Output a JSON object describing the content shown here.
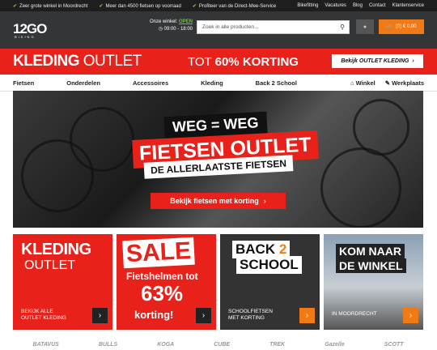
{
  "topbar": {
    "usps": [
      "Zeer grote winkel in Moordrecht",
      "Meer dan 4500 fietsen op voorraad",
      "Profiteer van de Direct-Mee-Service"
    ],
    "links": [
      "Bikefitting",
      "Vacatures",
      "Blog",
      "Contact",
      "Klantenservice"
    ]
  },
  "header": {
    "logo": "12GO",
    "logo_sub": "BIKING",
    "hours_label": "Onze winkel:",
    "hours_status": "OPEN",
    "hours_time": "09:00 - 18:00",
    "search_placeholder": "Zoek in alle producten...",
    "cart": "(0) € 0,00"
  },
  "outlet_bar": {
    "title_bold": "KLEDING",
    "title_rest": " OUTLET",
    "promo_pre": "TOT ",
    "promo_bold": "60% KORTING",
    "button": "Bekijk OUTLET KLEDING"
  },
  "nav": {
    "items": [
      "Fietsen",
      "Onderdelen",
      "Accessoires",
      "Kleding",
      "Back 2 School"
    ],
    "winkel": "Winkel",
    "werkplaats": "Werkplaats"
  },
  "hero": {
    "line1": "WEG = WEG",
    "line2": "FIETSEN OUTLET",
    "line3": "DE ALLERLAATSTE FIETSEN",
    "button": "Bekijk fietsen met korting"
  },
  "tiles": {
    "kleding": {
      "h1": "KLEDING",
      "h2": "OUTLET",
      "sub1": "BEKIJK ALLE",
      "sub2": "OUTLET KLEDING"
    },
    "sale": {
      "big": "SALE",
      "line2": "Fietshelmen tot",
      "pct": "63%",
      "line4": "korting!"
    },
    "back": {
      "b1": "BACK",
      "b2": "SCHOOL",
      "num": "2",
      "sub1": "SCHOOLFIETSEN",
      "sub2": "MET KORTING"
    },
    "winkel": {
      "w1": "KOM NAAR",
      "w2": "DE WINKEL",
      "sub": "IN MOORDRECHT"
    }
  },
  "brands": [
    "BATAVUS",
    "BULLS",
    "KOGA",
    "CUBE",
    "TREK",
    "Gazelle",
    "SCOTT"
  ],
  "colors": {
    "red": "#e8221b",
    "orange": "#f07a16",
    "dark": "#333537"
  }
}
